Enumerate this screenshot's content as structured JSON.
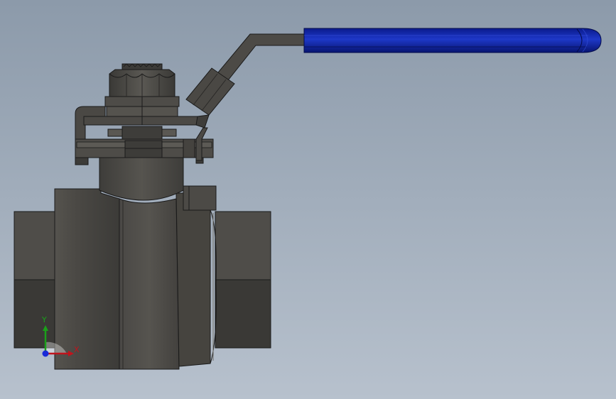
{
  "viewport": {
    "background_top": "#8c9aaa",
    "background_bottom": "#b7c1cd"
  },
  "model": {
    "body_color": "#4e4c48",
    "handle_color": "#0a1f9a",
    "edge_color": "#1a1a1a"
  },
  "triad": {
    "x_label": "X",
    "y_label": "Y",
    "x_color": "#c0141c",
    "y_color": "#1aa01a",
    "z_color": "#1a2ad8"
  }
}
